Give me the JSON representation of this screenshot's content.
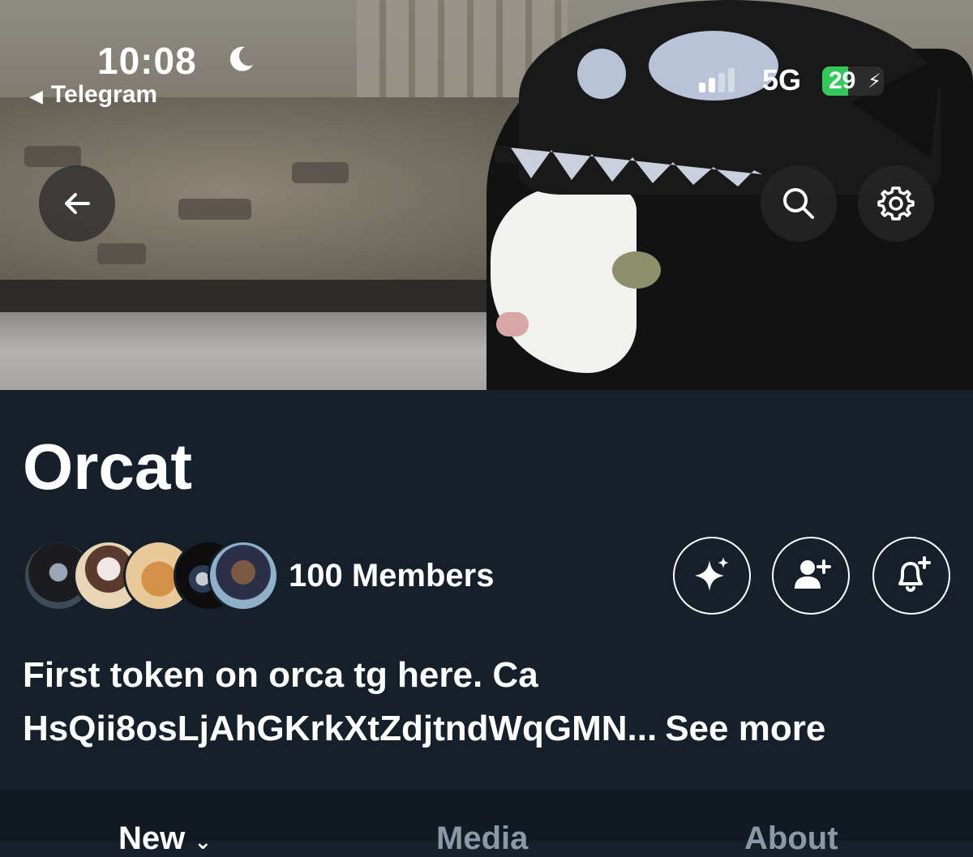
{
  "status_bar": {
    "time": "10:08",
    "back_app": "Telegram",
    "network": "5G",
    "battery": "29"
  },
  "header": {
    "back_icon": "arrow-left-icon",
    "search_icon": "search-icon",
    "settings_icon": "gear-icon"
  },
  "community": {
    "name": "Orcat",
    "members_label": "100 Members",
    "description": "First token on orca tg here. Ca HsQii8osLjAhGKrkXtZdjtndWqGMN...",
    "see_more": "See more"
  },
  "actions": [
    "sparkle-icon",
    "add-user-icon",
    "bell-plus-icon"
  ],
  "tabs": [
    {
      "label": "New"
    },
    {
      "label": "Media"
    },
    {
      "label": "About"
    }
  ],
  "colors": {
    "background": "#15202b",
    "text": "#ffffff",
    "muted": "#8b98a5",
    "battery": "#34c759"
  }
}
